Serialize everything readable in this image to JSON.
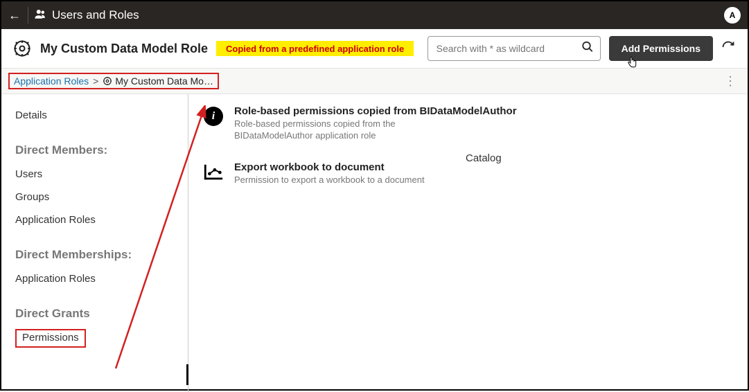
{
  "topbar": {
    "title": "Users and Roles",
    "avatar_initial": "A"
  },
  "subheader": {
    "role_name": "My Custom Data Model Role",
    "note": "Copied from a predefined application role",
    "search_placeholder": "Search with * as wildcard",
    "add_button": "Add Permissions"
  },
  "breadcrumb": {
    "root": "Application Roles",
    "separator": ">",
    "current": "My Custom Data Mo…"
  },
  "sidebar": {
    "details": "Details",
    "section1_head": "Direct Members:",
    "section1_items": [
      "Users",
      "Groups",
      "Application Roles"
    ],
    "section2_head": "Direct Memberships:",
    "section2_items": [
      "Application Roles"
    ],
    "section3_head": "Direct Grants",
    "permissions": "Permissions"
  },
  "permissions_list": [
    {
      "title": "Role-based permissions copied from BIDataModelAuthor",
      "desc": "Role-based permissions copied from the BIDataModelAuthor application role",
      "icon": "info"
    },
    {
      "title": "Export workbook to document",
      "desc": "Permission to export a workbook to a document",
      "context": "Catalog",
      "icon": "chart"
    }
  ]
}
